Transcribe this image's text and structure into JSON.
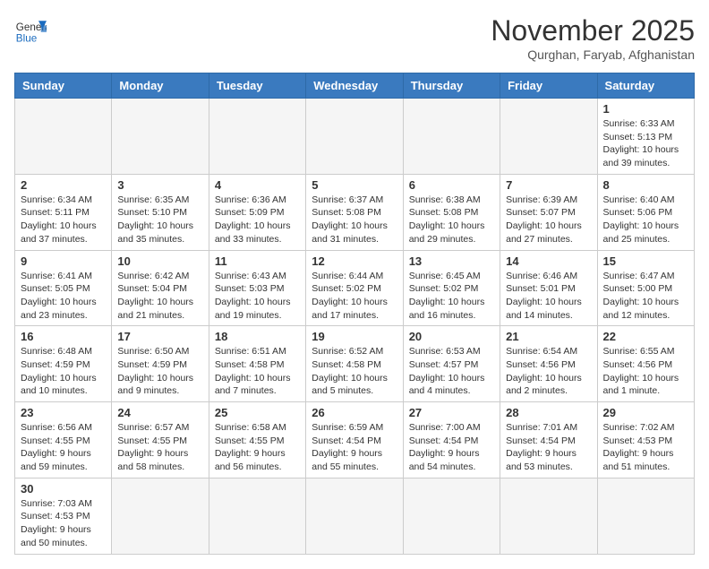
{
  "header": {
    "logo_general": "General",
    "logo_blue": "Blue",
    "month_title": "November 2025",
    "location": "Qurghan, Faryab, Afghanistan"
  },
  "days_of_week": [
    "Sunday",
    "Monday",
    "Tuesday",
    "Wednesday",
    "Thursday",
    "Friday",
    "Saturday"
  ],
  "weeks": [
    [
      {
        "day": "",
        "info": ""
      },
      {
        "day": "",
        "info": ""
      },
      {
        "day": "",
        "info": ""
      },
      {
        "day": "",
        "info": ""
      },
      {
        "day": "",
        "info": ""
      },
      {
        "day": "",
        "info": ""
      },
      {
        "day": "1",
        "info": "Sunrise: 6:33 AM\nSunset: 5:13 PM\nDaylight: 10 hours and 39 minutes."
      }
    ],
    [
      {
        "day": "2",
        "info": "Sunrise: 6:34 AM\nSunset: 5:11 PM\nDaylight: 10 hours and 37 minutes."
      },
      {
        "day": "3",
        "info": "Sunrise: 6:35 AM\nSunset: 5:10 PM\nDaylight: 10 hours and 35 minutes."
      },
      {
        "day": "4",
        "info": "Sunrise: 6:36 AM\nSunset: 5:09 PM\nDaylight: 10 hours and 33 minutes."
      },
      {
        "day": "5",
        "info": "Sunrise: 6:37 AM\nSunset: 5:08 PM\nDaylight: 10 hours and 31 minutes."
      },
      {
        "day": "6",
        "info": "Sunrise: 6:38 AM\nSunset: 5:08 PM\nDaylight: 10 hours and 29 minutes."
      },
      {
        "day": "7",
        "info": "Sunrise: 6:39 AM\nSunset: 5:07 PM\nDaylight: 10 hours and 27 minutes."
      },
      {
        "day": "8",
        "info": "Sunrise: 6:40 AM\nSunset: 5:06 PM\nDaylight: 10 hours and 25 minutes."
      }
    ],
    [
      {
        "day": "9",
        "info": "Sunrise: 6:41 AM\nSunset: 5:05 PM\nDaylight: 10 hours and 23 minutes."
      },
      {
        "day": "10",
        "info": "Sunrise: 6:42 AM\nSunset: 5:04 PM\nDaylight: 10 hours and 21 minutes."
      },
      {
        "day": "11",
        "info": "Sunrise: 6:43 AM\nSunset: 5:03 PM\nDaylight: 10 hours and 19 minutes."
      },
      {
        "day": "12",
        "info": "Sunrise: 6:44 AM\nSunset: 5:02 PM\nDaylight: 10 hours and 17 minutes."
      },
      {
        "day": "13",
        "info": "Sunrise: 6:45 AM\nSunset: 5:02 PM\nDaylight: 10 hours and 16 minutes."
      },
      {
        "day": "14",
        "info": "Sunrise: 6:46 AM\nSunset: 5:01 PM\nDaylight: 10 hours and 14 minutes."
      },
      {
        "day": "15",
        "info": "Sunrise: 6:47 AM\nSunset: 5:00 PM\nDaylight: 10 hours and 12 minutes."
      }
    ],
    [
      {
        "day": "16",
        "info": "Sunrise: 6:48 AM\nSunset: 4:59 PM\nDaylight: 10 hours and 10 minutes."
      },
      {
        "day": "17",
        "info": "Sunrise: 6:50 AM\nSunset: 4:59 PM\nDaylight: 10 hours and 9 minutes."
      },
      {
        "day": "18",
        "info": "Sunrise: 6:51 AM\nSunset: 4:58 PM\nDaylight: 10 hours and 7 minutes."
      },
      {
        "day": "19",
        "info": "Sunrise: 6:52 AM\nSunset: 4:58 PM\nDaylight: 10 hours and 5 minutes."
      },
      {
        "day": "20",
        "info": "Sunrise: 6:53 AM\nSunset: 4:57 PM\nDaylight: 10 hours and 4 minutes."
      },
      {
        "day": "21",
        "info": "Sunrise: 6:54 AM\nSunset: 4:56 PM\nDaylight: 10 hours and 2 minutes."
      },
      {
        "day": "22",
        "info": "Sunrise: 6:55 AM\nSunset: 4:56 PM\nDaylight: 10 hours and 1 minute."
      }
    ],
    [
      {
        "day": "23",
        "info": "Sunrise: 6:56 AM\nSunset: 4:55 PM\nDaylight: 9 hours and 59 minutes."
      },
      {
        "day": "24",
        "info": "Sunrise: 6:57 AM\nSunset: 4:55 PM\nDaylight: 9 hours and 58 minutes."
      },
      {
        "day": "25",
        "info": "Sunrise: 6:58 AM\nSunset: 4:55 PM\nDaylight: 9 hours and 56 minutes."
      },
      {
        "day": "26",
        "info": "Sunrise: 6:59 AM\nSunset: 4:54 PM\nDaylight: 9 hours and 55 minutes."
      },
      {
        "day": "27",
        "info": "Sunrise: 7:00 AM\nSunset: 4:54 PM\nDaylight: 9 hours and 54 minutes."
      },
      {
        "day": "28",
        "info": "Sunrise: 7:01 AM\nSunset: 4:54 PM\nDaylight: 9 hours and 53 minutes."
      },
      {
        "day": "29",
        "info": "Sunrise: 7:02 AM\nSunset: 4:53 PM\nDaylight: 9 hours and 51 minutes."
      }
    ],
    [
      {
        "day": "30",
        "info": "Sunrise: 7:03 AM\nSunset: 4:53 PM\nDaylight: 9 hours and 50 minutes."
      },
      {
        "day": "",
        "info": ""
      },
      {
        "day": "",
        "info": ""
      },
      {
        "day": "",
        "info": ""
      },
      {
        "day": "",
        "info": ""
      },
      {
        "day": "",
        "info": ""
      },
      {
        "day": "",
        "info": ""
      }
    ]
  ]
}
